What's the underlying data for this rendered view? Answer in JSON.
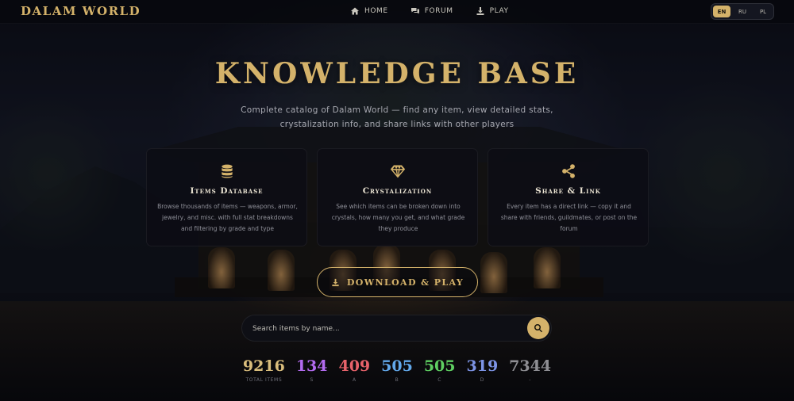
{
  "brand": {
    "logo": "DALAM WORLD",
    "accent": "#d4b26a"
  },
  "nav": {
    "items": [
      {
        "label": "HOME",
        "icon": "home-icon"
      },
      {
        "label": "FORUM",
        "icon": "forum-icon"
      },
      {
        "label": "PLAY",
        "icon": "download-icon"
      }
    ]
  },
  "languages": {
    "options": [
      "EN",
      "RU",
      "PL"
    ],
    "selected": "EN"
  },
  "hero": {
    "title": "KNOWLEDGE BASE",
    "subtitle": "Complete catalog of Dalam World — find any item, view detailed stats, crystalization info, and share links with other players"
  },
  "features": [
    {
      "icon": "database-icon",
      "title": "Items Database",
      "description": "Browse thousands of items — weapons, armor, jewelry, and misc. with full stat breakdowns and filtering by grade and type"
    },
    {
      "icon": "gem-icon",
      "title": "Crystalization",
      "description": "See which items can be broken down into crystals, how many you get, and what grade they produce"
    },
    {
      "icon": "share-icon",
      "title": "Share & Link",
      "description": "Every item has a direct link — copy it and share with friends, guildmates, or post on the forum"
    }
  ],
  "download": {
    "label": "DOWNLOAD & PLAY",
    "icon": "download-icon"
  },
  "search": {
    "placeholder": "Search items by name...",
    "value": "",
    "icon": "search-icon"
  },
  "stats": [
    {
      "value": "9216",
      "label": "TOTAL ITEMS",
      "color": "#d9bd7c"
    },
    {
      "value": "134",
      "label": "S",
      "color": "#b36bf0"
    },
    {
      "value": "409",
      "label": "A",
      "color": "#e7626a"
    },
    {
      "value": "505",
      "label": "B",
      "color": "#62a8ea"
    },
    {
      "value": "505",
      "label": "C",
      "color": "#5fcf62"
    },
    {
      "value": "319",
      "label": "D",
      "color": "#7d94e6"
    },
    {
      "value": "7344",
      "label": "-",
      "color": "#8f8f94"
    }
  ]
}
